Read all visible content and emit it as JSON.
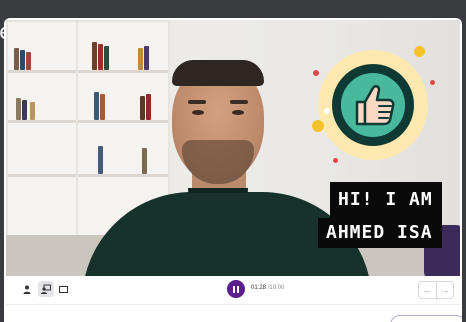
{
  "window": {
    "edge_glyph": "e"
  },
  "video": {
    "caption_line_1": "HI! I AM",
    "caption_line_2": "AHMED ISA",
    "badge_icon": "thumbs-up-icon",
    "colors": {
      "caption_bg": "#0a0a0a",
      "caption_text": "#ffffff",
      "badge_green": "#49b99c",
      "badge_dark": "#0f3a33",
      "badge_glow": "#fde8b0"
    }
  },
  "controls": {
    "layout_buttons": [
      {
        "icon": "person-icon",
        "active": false
      },
      {
        "icon": "person-screen-icon",
        "active": true
      },
      {
        "icon": "screen-icon",
        "active": false
      }
    ],
    "play_state_icon": "pause-icon",
    "current_time": "01:28",
    "separator": "/",
    "total_time": "10:00",
    "prev_icon": "arrow-left-icon",
    "next_icon": "arrow-right-icon",
    "accent_color": "#5a1f8c"
  }
}
